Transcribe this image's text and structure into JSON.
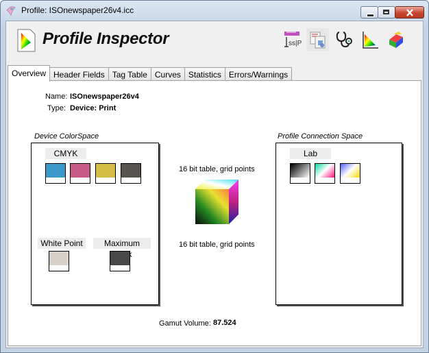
{
  "window": {
    "title": "Profile: ISOnewspaper26v4.icc"
  },
  "app": {
    "title": "Profile Inspector"
  },
  "toolbar": {
    "icons": [
      "tag-info-icon",
      "copy-tags-icon",
      "stethoscope-icon",
      "gamut-view-icon",
      "colorspace-icon"
    ]
  },
  "tabs": [
    {
      "label": "Overview",
      "active": true
    },
    {
      "label": "Header Fields",
      "active": false
    },
    {
      "label": "Tag Table",
      "active": false
    },
    {
      "label": "Curves",
      "active": false
    },
    {
      "label": "Statistics",
      "active": false
    },
    {
      "label": "Errors/Warnings",
      "active": false
    }
  ],
  "overview": {
    "name_label": "Name:",
    "name_value": "ISOnewspaper26v4",
    "type_label": "Type:",
    "type_value": "Device: Print",
    "device_caption": "Device ColorSpace",
    "device_space": "CMYK",
    "device_swatches": [
      {
        "name": "cyan",
        "color": "#3b9ac8"
      },
      {
        "name": "magenta",
        "color": "#c75b85"
      },
      {
        "name": "yellow",
        "color": "#d4c049"
      },
      {
        "name": "black",
        "color": "#57534f"
      }
    ],
    "white_point_label": "White Point",
    "white_point_color": "#d8d1c9",
    "max_black_label": "Maximum Black",
    "max_black_color": "#484848",
    "table_top": "16 bit table,  grid points",
    "table_bottom": "16 bit table,  grid points",
    "pcs_caption": "Profile Connection Space",
    "pcs_space": "Lab",
    "gamut_label": "Gamut Volume:",
    "gamut_value": "87.524"
  }
}
